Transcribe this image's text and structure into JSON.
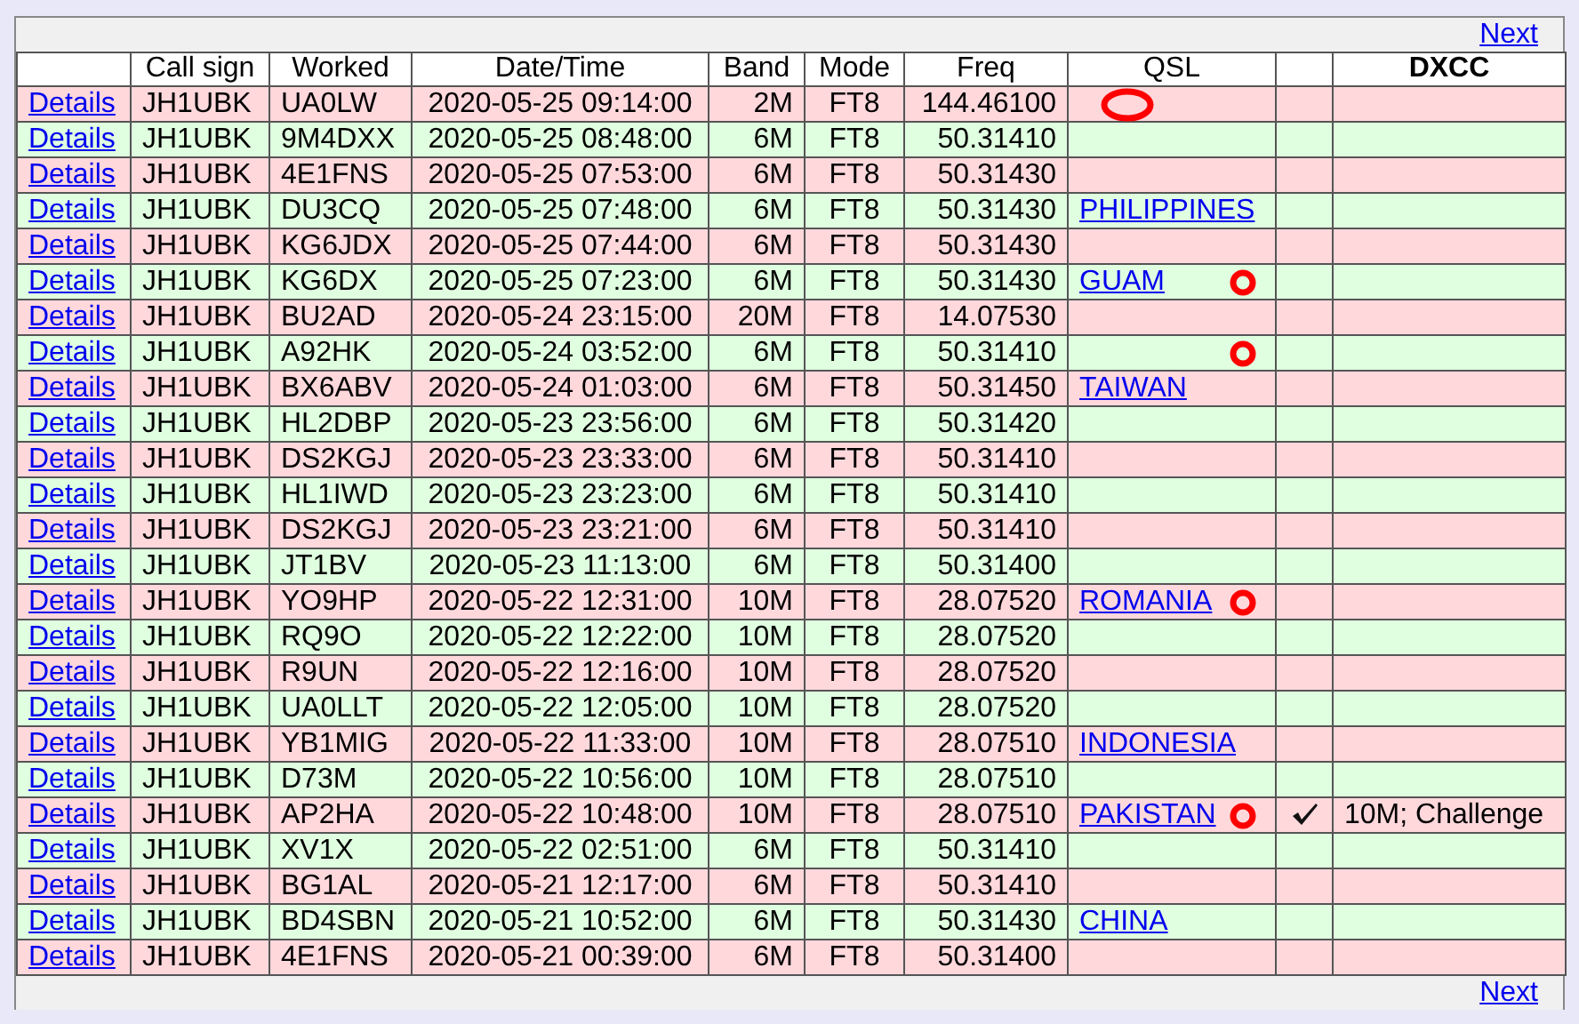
{
  "pager_top": {
    "label": "Next"
  },
  "columns": [
    "",
    "Call sign",
    "Worked",
    "Date/Time",
    "Band",
    "Mode",
    "Freq",
    "QSL",
    "",
    "DXCC"
  ],
  "rows": [
    {
      "link": "Details",
      "call": "JH1UBK",
      "worked": "UA0LW",
      "datetime": "2020-05-25 09:14:00",
      "band": "2M",
      "mode": "FT8",
      "freq": "144.46100",
      "qsl": "",
      "oval": true,
      "ring": false,
      "checked": false,
      "dxcc": "",
      "color": "#ffd8dc"
    },
    {
      "link": "Details",
      "call": "JH1UBK",
      "worked": "9M4DXX",
      "datetime": "2020-05-25 08:48:00",
      "band": "6M",
      "mode": "FT8",
      "freq": "50.31410",
      "qsl": "",
      "oval": false,
      "ring": false,
      "checked": false,
      "dxcc": "",
      "color": "#e0ffe0"
    },
    {
      "link": "Details",
      "call": "JH1UBK",
      "worked": "4E1FNS",
      "datetime": "2020-05-25 07:53:00",
      "band": "6M",
      "mode": "FT8",
      "freq": "50.31430",
      "qsl": "",
      "oval": false,
      "ring": false,
      "checked": false,
      "dxcc": "",
      "color": "#ffd8dc"
    },
    {
      "link": "Details",
      "call": "JH1UBK",
      "worked": "DU3CQ",
      "datetime": "2020-05-25 07:48:00",
      "band": "6M",
      "mode": "FT8",
      "freq": "50.31430",
      "qsl": "PHILIPPINES",
      "oval": false,
      "ring": false,
      "checked": false,
      "dxcc": "",
      "color": "#e0ffe0"
    },
    {
      "link": "Details",
      "call": "JH1UBK",
      "worked": "KG6JDX",
      "datetime": "2020-05-25 07:44:00",
      "band": "6M",
      "mode": "FT8",
      "freq": "50.31430",
      "qsl": "",
      "oval": false,
      "ring": false,
      "checked": false,
      "dxcc": "",
      "color": "#ffd8dc"
    },
    {
      "link": "Details",
      "call": "JH1UBK",
      "worked": "KG6DX",
      "datetime": "2020-05-25 07:23:00",
      "band": "6M",
      "mode": "FT8",
      "freq": "50.31430",
      "qsl": "GUAM",
      "oval": false,
      "ring": true,
      "checked": false,
      "dxcc": "",
      "color": "#e0ffe0"
    },
    {
      "link": "Details",
      "call": "JH1UBK",
      "worked": "BU2AD",
      "datetime": "2020-05-24 23:15:00",
      "band": "20M",
      "mode": "FT8",
      "freq": "14.07530",
      "qsl": "",
      "oval": false,
      "ring": false,
      "checked": false,
      "dxcc": "",
      "color": "#ffd8dc"
    },
    {
      "link": "Details",
      "call": "JH1UBK",
      "worked": "A92HK",
      "datetime": "2020-05-24 03:52:00",
      "band": "6M",
      "mode": "FT8",
      "freq": "50.31410",
      "qsl": "",
      "oval": false,
      "ring": true,
      "checked": false,
      "dxcc": "",
      "color": "#e0ffe0"
    },
    {
      "link": "Details",
      "call": "JH1UBK",
      "worked": "BX6ABV",
      "datetime": "2020-05-24 01:03:00",
      "band": "6M",
      "mode": "FT8",
      "freq": "50.31450",
      "qsl": "TAIWAN",
      "oval": false,
      "ring": false,
      "checked": false,
      "dxcc": "",
      "color": "#ffd8dc"
    },
    {
      "link": "Details",
      "call": "JH1UBK",
      "worked": "HL2DBP",
      "datetime": "2020-05-23 23:56:00",
      "band": "6M",
      "mode": "FT8",
      "freq": "50.31420",
      "qsl": "",
      "oval": false,
      "ring": false,
      "checked": false,
      "dxcc": "",
      "color": "#e0ffe0"
    },
    {
      "link": "Details",
      "call": "JH1UBK",
      "worked": "DS2KGJ",
      "datetime": "2020-05-23 23:33:00",
      "band": "6M",
      "mode": "FT8",
      "freq": "50.31410",
      "qsl": "",
      "oval": false,
      "ring": false,
      "checked": false,
      "dxcc": "",
      "color": "#ffd8dc"
    },
    {
      "link": "Details",
      "call": "JH1UBK",
      "worked": "HL1IWD",
      "datetime": "2020-05-23 23:23:00",
      "band": "6M",
      "mode": "FT8",
      "freq": "50.31410",
      "qsl": "",
      "oval": false,
      "ring": false,
      "checked": false,
      "dxcc": "",
      "color": "#e0ffe0"
    },
    {
      "link": "Details",
      "call": "JH1UBK",
      "worked": "DS2KGJ",
      "datetime": "2020-05-23 23:21:00",
      "band": "6M",
      "mode": "FT8",
      "freq": "50.31410",
      "qsl": "",
      "oval": false,
      "ring": false,
      "checked": false,
      "dxcc": "",
      "color": "#ffd8dc"
    },
    {
      "link": "Details",
      "call": "JH1UBK",
      "worked": "JT1BV",
      "datetime": "2020-05-23 11:13:00",
      "band": "6M",
      "mode": "FT8",
      "freq": "50.31400",
      "qsl": "",
      "oval": false,
      "ring": false,
      "checked": false,
      "dxcc": "",
      "color": "#e0ffe0"
    },
    {
      "link": "Details",
      "call": "JH1UBK",
      "worked": "YO9HP",
      "datetime": "2020-05-22 12:31:00",
      "band": "10M",
      "mode": "FT8",
      "freq": "28.07520",
      "qsl": "ROMANIA",
      "oval": false,
      "ring": true,
      "checked": false,
      "dxcc": "",
      "color": "#ffd8dc"
    },
    {
      "link": "Details",
      "call": "JH1UBK",
      "worked": "RQ9O",
      "datetime": "2020-05-22 12:22:00",
      "band": "10M",
      "mode": "FT8",
      "freq": "28.07520",
      "qsl": "",
      "oval": false,
      "ring": false,
      "checked": false,
      "dxcc": "",
      "color": "#e0ffe0"
    },
    {
      "link": "Details",
      "call": "JH1UBK",
      "worked": "R9UN",
      "datetime": "2020-05-22 12:16:00",
      "band": "10M",
      "mode": "FT8",
      "freq": "28.07520",
      "qsl": "",
      "oval": false,
      "ring": false,
      "checked": false,
      "dxcc": "",
      "color": "#ffd8dc"
    },
    {
      "link": "Details",
      "call": "JH1UBK",
      "worked": "UA0LLT",
      "datetime": "2020-05-22 12:05:00",
      "band": "10M",
      "mode": "FT8",
      "freq": "28.07520",
      "qsl": "",
      "oval": false,
      "ring": false,
      "checked": false,
      "dxcc": "",
      "color": "#e0ffe0"
    },
    {
      "link": "Details",
      "call": "JH1UBK",
      "worked": "YB1MIG",
      "datetime": "2020-05-22 11:33:00",
      "band": "10M",
      "mode": "FT8",
      "freq": "28.07510",
      "qsl": "INDONESIA",
      "oval": false,
      "ring": false,
      "checked": false,
      "dxcc": "",
      "color": "#ffd8dc"
    },
    {
      "link": "Details",
      "call": "JH1UBK",
      "worked": "D73M",
      "datetime": "2020-05-22 10:56:00",
      "band": "10M",
      "mode": "FT8",
      "freq": "28.07510",
      "qsl": "",
      "oval": false,
      "ring": false,
      "checked": false,
      "dxcc": "",
      "color": "#e0ffe0"
    },
    {
      "link": "Details",
      "call": "JH1UBK",
      "worked": "AP2HA",
      "datetime": "2020-05-22 10:48:00",
      "band": "10M",
      "mode": "FT8",
      "freq": "28.07510",
      "qsl": "PAKISTAN",
      "oval": false,
      "ring": true,
      "checked": true,
      "dxcc": "10M; Challenge",
      "color": "#ffd8dc"
    },
    {
      "link": "Details",
      "call": "JH1UBK",
      "worked": "XV1X",
      "datetime": "2020-05-22 02:51:00",
      "band": "6M",
      "mode": "FT8",
      "freq": "50.31410",
      "qsl": "",
      "oval": false,
      "ring": false,
      "checked": false,
      "dxcc": "",
      "color": "#e0ffe0"
    },
    {
      "link": "Details",
      "call": "JH1UBK",
      "worked": "BG1AL",
      "datetime": "2020-05-21 12:17:00",
      "band": "6M",
      "mode": "FT8",
      "freq": "50.31410",
      "qsl": "",
      "oval": false,
      "ring": false,
      "checked": false,
      "dxcc": "",
      "color": "#ffd8dc"
    },
    {
      "link": "Details",
      "call": "JH1UBK",
      "worked": "BD4SBN",
      "datetime": "2020-05-21 10:52:00",
      "band": "6M",
      "mode": "FT8",
      "freq": "50.31430",
      "qsl": "CHINA",
      "oval": false,
      "ring": false,
      "checked": false,
      "dxcc": "",
      "color": "#e0ffe0"
    },
    {
      "link": "Details",
      "call": "JH1UBK",
      "worked": "4E1FNS",
      "datetime": "2020-05-21 00:39:00",
      "band": "6M",
      "mode": "FT8",
      "freq": "50.31400",
      "qsl": "",
      "oval": false,
      "ring": false,
      "checked": false,
      "dxcc": "",
      "color": "#ffd8dc"
    }
  ],
  "pager_bottom": {
    "label": "Next"
  }
}
